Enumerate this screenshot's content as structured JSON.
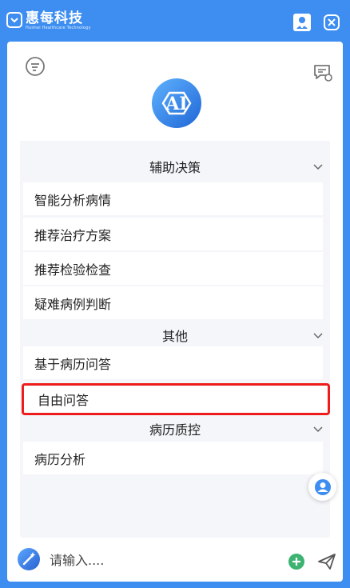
{
  "app": {
    "brand_name": "惠每科技",
    "brand_sub": "Huimei Healthcare Technology"
  },
  "sections": [
    {
      "title": "辅助决策",
      "items": [
        "智能分析病情",
        "推荐治疗方案",
        "推荐检验检查",
        "疑难病例判断"
      ]
    },
    {
      "title": "其他",
      "items": [
        "基于病历问答",
        "自由问答"
      ]
    },
    {
      "title": "病历质控",
      "items": [
        "病历分析"
      ]
    }
  ],
  "selected_item": "自由问答",
  "input": {
    "placeholder": "请输入....",
    "value": ""
  },
  "colors": {
    "brand_blue": "#3d8ef0",
    "selection_red": "#ee1c1c",
    "add_green": "#3cb371"
  },
  "icons": {
    "filter": "filter-icon",
    "chat_settings": "chat-settings-icon",
    "ai_logo": "ai-logo",
    "section_toggle": "chevron-down-icon",
    "assistant": "assistant-icon",
    "magic": "magic-wand-icon",
    "add": "plus-circle-icon",
    "send": "send-icon"
  }
}
